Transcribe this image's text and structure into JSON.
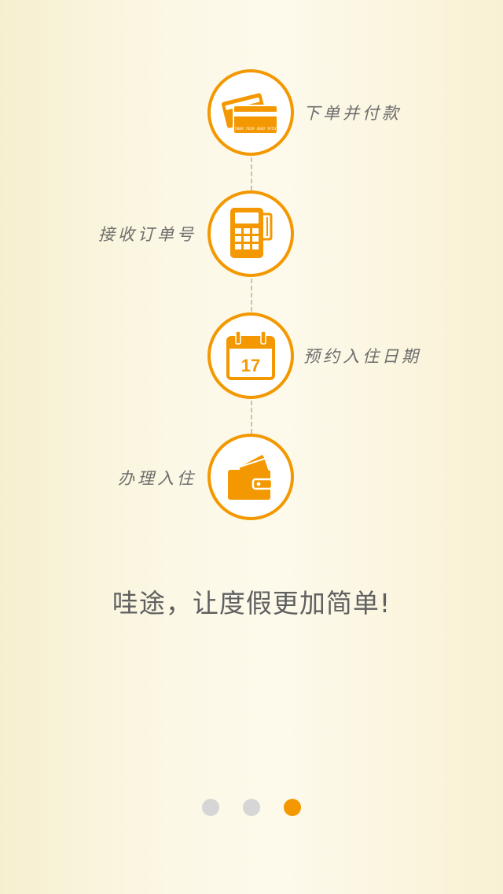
{
  "steps": [
    {
      "label": "下单并付款",
      "icon": "credit-card-icon"
    },
    {
      "label": "接收订单号",
      "icon": "pos-terminal-icon"
    },
    {
      "label": "预约入住日期",
      "icon": "calendar-icon",
      "calendar_day": "17"
    },
    {
      "label": "办理入住",
      "icon": "wallet-icon"
    }
  ],
  "tagline": "哇途，让度假更加简单!",
  "card_number_text": "5869 7659 4692 9753",
  "pager": {
    "pages": 3,
    "current": 3
  },
  "colors": {
    "accent": "#f39800",
    "dot_inactive": "#d6d6d6",
    "text": "#606060"
  }
}
